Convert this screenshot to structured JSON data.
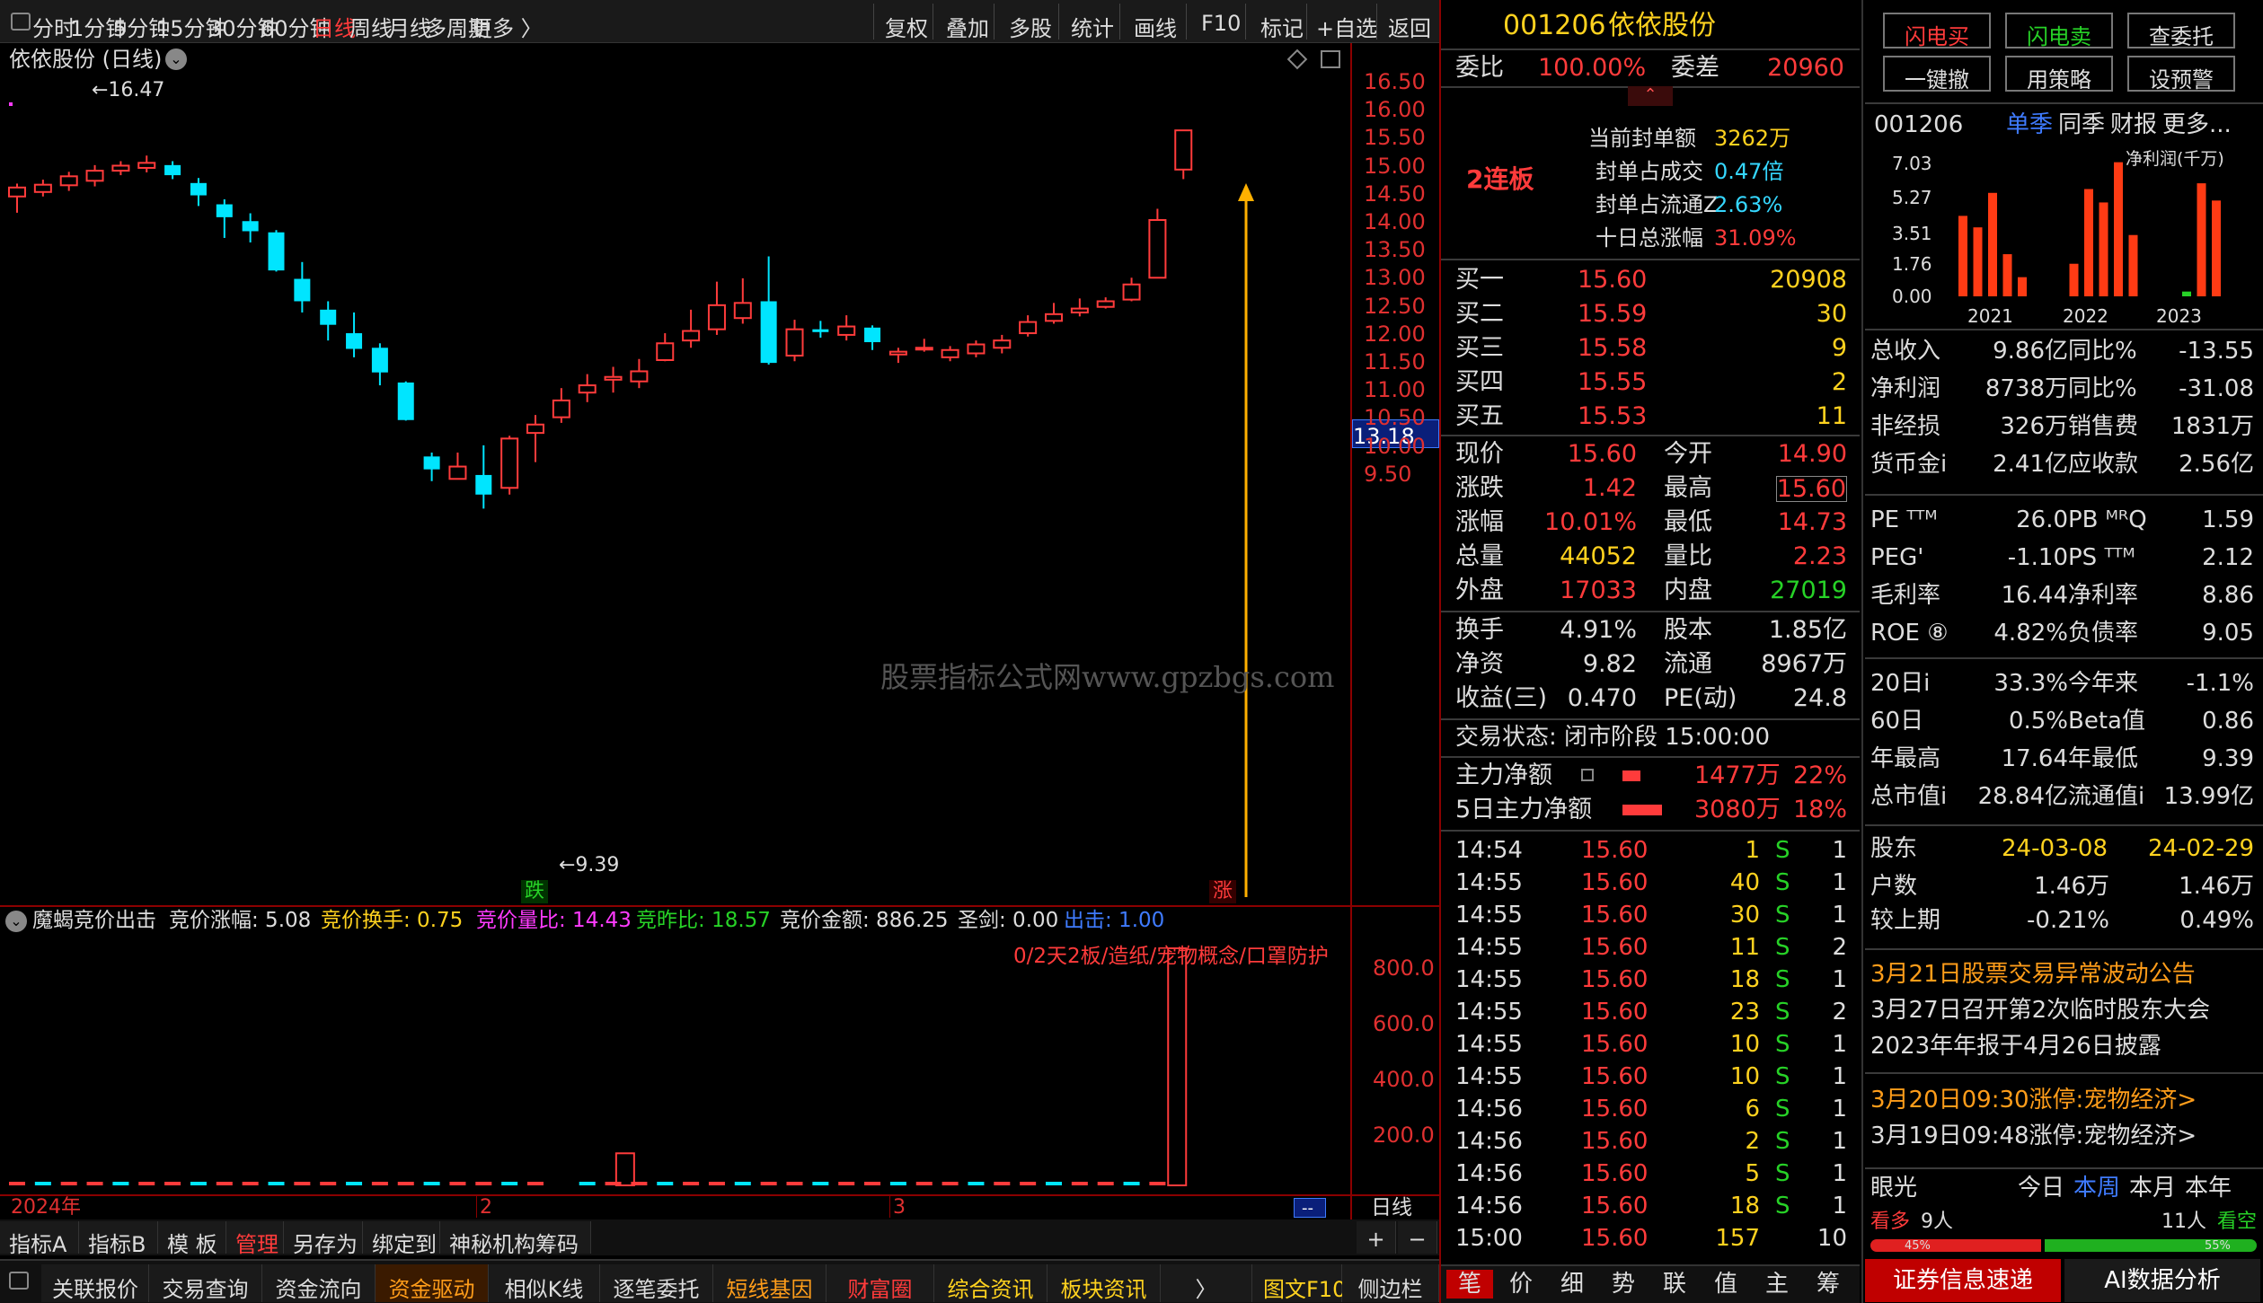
{
  "toolbar": {
    "periods": [
      "分时",
      "1分钟",
      "5分钟",
      "15分钟",
      "30分钟",
      "60分钟",
      "日线",
      "周线",
      "月线",
      "多周期",
      "更多 〉"
    ],
    "tools": [
      "复权",
      "叠加",
      "多股",
      "统计",
      "画线",
      "F10",
      "标记",
      "+自选",
      "返回"
    ]
  },
  "chart": {
    "title": "依依股份 (日线)",
    "high_label": "←16.47",
    "low_label": "←9.39",
    "watermark": "股票指标公式网www.gpzbgs.com",
    "current_price_tag": "13.18",
    "drop_tag": "跌",
    "rise_tag": "涨",
    "y_labels": [
      "16.50",
      "16.00",
      "15.50",
      "15.00",
      "14.50",
      "14.00",
      "13.50",
      "13.00",
      "12.50",
      "12.00",
      "11.50",
      "11.00",
      "10.50",
      "10.00",
      "9.50"
    ],
    "time_labels": [
      "2024年",
      "2",
      "3"
    ],
    "period_label": "日线",
    "nav": "--"
  },
  "chart_data": {
    "type": "candlestick",
    "title": "依依股份 (日线)",
    "ylim": [
      9.2,
      16.7
    ],
    "candles": [
      [
        14.42,
        14.58,
        14.13,
        14.65
      ],
      [
        14.5,
        14.63,
        14.42,
        14.72
      ],
      [
        14.62,
        14.78,
        14.52,
        14.86
      ],
      [
        14.7,
        14.88,
        14.6,
        14.98
      ],
      [
        14.88,
        14.97,
        14.8,
        15.05
      ],
      [
        14.93,
        15.02,
        14.85,
        15.15
      ],
      [
        14.98,
        14.8,
        14.73,
        15.05
      ],
      [
        14.66,
        14.44,
        14.25,
        14.75
      ],
      [
        14.28,
        14.05,
        13.68,
        14.37
      ],
      [
        13.98,
        13.8,
        13.6,
        14.12
      ],
      [
        13.78,
        13.1,
        13.08,
        13.82
      ],
      [
        12.95,
        12.55,
        12.35,
        13.25
      ],
      [
        12.4,
        12.13,
        11.85,
        12.55
      ],
      [
        11.98,
        11.7,
        11.55,
        12.35
      ],
      [
        11.72,
        11.28,
        11.05,
        11.8
      ],
      [
        11.1,
        10.43,
        10.42,
        11.12
      ],
      [
        9.78,
        9.55,
        9.34,
        9.85
      ],
      [
        9.38,
        9.6,
        9.39,
        9.85
      ],
      [
        9.45,
        9.1,
        8.85,
        9.98
      ],
      [
        9.22,
        10.1,
        9.1,
        10.15
      ],
      [
        10.2,
        10.35,
        9.68,
        10.52
      ],
      [
        10.48,
        10.78,
        10.38,
        11.0
      ],
      [
        10.92,
        11.05,
        10.75,
        11.25
      ],
      [
        11.15,
        11.2,
        10.92,
        11.38
      ],
      [
        11.12,
        11.3,
        11.0,
        11.52
      ],
      [
        11.5,
        11.8,
        11.48,
        11.98
      ],
      [
        11.85,
        12.02,
        11.72,
        12.4
      ],
      [
        12.05,
        12.48,
        11.95,
        12.9
      ],
      [
        12.25,
        12.52,
        12.15,
        12.96
      ],
      [
        12.55,
        11.45,
        11.42,
        13.35
      ],
      [
        11.58,
        12.05,
        11.48,
        12.22
      ],
      [
        12.05,
        12.0,
        11.9,
        12.2
      ],
      [
        11.95,
        12.1,
        11.85,
        12.3
      ],
      [
        12.08,
        11.82,
        11.68,
        12.12
      ],
      [
        11.6,
        11.65,
        11.45,
        11.72
      ],
      [
        11.7,
        11.72,
        11.65,
        11.88
      ],
      [
        11.55,
        11.68,
        11.48,
        11.75
      ],
      [
        11.62,
        11.78,
        11.55,
        11.85
      ],
      [
        11.72,
        11.85,
        11.62,
        11.95
      ],
      [
        11.98,
        12.18,
        11.92,
        12.3
      ],
      [
        12.2,
        12.32,
        12.15,
        12.52
      ],
      [
        12.35,
        12.42,
        12.28,
        12.6
      ],
      [
        12.45,
        12.55,
        12.42,
        12.62
      ],
      [
        12.58,
        12.85,
        12.55,
        12.97
      ],
      [
        12.97,
        14.0,
        12.97,
        14.2
      ],
      [
        14.9,
        15.6,
        14.73,
        15.6
      ]
    ],
    "marker_up_price": 14.56
  },
  "indicator": {
    "name": "魔蝎竞价出击",
    "items": [
      {
        "label": "竞价涨幅: 5.08",
        "color": "#dddddd"
      },
      {
        "label": "竞价换手: 0.75",
        "color": "#ffd21f"
      },
      {
        "label": "竞价量比: 14.43",
        "color": "#ff3bff"
      },
      {
        "label": "竞昨比: 18.57",
        "color": "#27d227"
      },
      {
        "label": "竞价金额: 886.25",
        "color": "#dddddd"
      },
      {
        "label": "圣剑: 0.00",
        "color": "#dddddd"
      },
      {
        "label": "出击: 1.00",
        "color": "#3f7bff"
      }
    ],
    "note": "0/2天2板/造纸/宠物概念/口罩防护",
    "y_labels": [
      "800.0",
      "600.0",
      "400.0",
      "200.0"
    ],
    "ylim": [
      0,
      1000
    ],
    "bars": [
      12,
      10,
      15,
      10,
      18,
      12,
      14,
      9,
      11,
      13,
      16,
      10,
      12,
      14,
      13,
      11,
      12,
      15,
      10,
      12,
      11,
      115,
      14,
      12,
      10,
      9,
      11,
      10,
      13,
      12,
      14,
      10,
      12,
      11,
      9,
      10,
      12,
      11,
      13,
      12,
      11,
      10,
      14,
      13,
      12,
      886.25
    ]
  },
  "bottom_tabs1": [
    "指标A",
    "指标B",
    "模 板",
    "管理",
    "另存为",
    "绑定到",
    "神秘机构筹码"
  ],
  "bottom_tabs1_right": [
    "+",
    "−"
  ],
  "bottom_tabs2": [
    "关联报价",
    "交易查询",
    "资金流向",
    "资金驱动",
    "相似K线",
    "逐笔委托",
    "短线基因",
    "财富圈",
    "综合资讯",
    "板块资讯",
    "〉",
    "图文F10",
    "侧边栏"
  ],
  "stock": {
    "code": "001206",
    "name": "依依股份",
    "weibi_label": "委比",
    "weibi": "100.00%",
    "weicha_label": "委差",
    "weicha": "20960",
    "board": "2连板",
    "seal": [
      {
        "label": "当前封单额",
        "value": "3262万",
        "vc": "#ffd21f"
      },
      {
        "label": "封单占成交",
        "value": "0.47倍",
        "vc": "#35d7ff"
      },
      {
        "label": "封单占流通Z",
        "value": "2.63%",
        "vc": "#35d7ff"
      },
      {
        "label": "十日总涨幅",
        "value": "31.09%",
        "vc": "#ff3b3b"
      }
    ],
    "bids": [
      {
        "label": "买一",
        "price": "15.60",
        "vol": "20908"
      },
      {
        "label": "买二",
        "price": "15.59",
        "vol": "30"
      },
      {
        "label": "买三",
        "price": "15.58",
        "vol": "9"
      },
      {
        "label": "买四",
        "price": "15.55",
        "vol": "2"
      },
      {
        "label": "买五",
        "price": "15.53",
        "vol": "11"
      }
    ],
    "quote": [
      [
        "现价",
        "15.60",
        "#ff3b3b",
        "今开",
        "14.90",
        "#ff3b3b"
      ],
      [
        "涨跌",
        "1.42",
        "#ff3b3b",
        "最高",
        "15.60",
        "#ff3b3b"
      ],
      [
        "涨幅",
        "10.01%",
        "#ff3b3b",
        "最低",
        "14.73",
        "#ff3b3b"
      ],
      [
        "总量",
        "44052",
        "#ffd21f",
        "量比",
        "2.23",
        "#ff3b3b"
      ],
      [
        "外盘",
        "17033",
        "#ff3b3b",
        "内盘",
        "27019",
        "#27d227"
      ]
    ],
    "quote2": [
      [
        "换手",
        "4.91%",
        "股本",
        "1.85亿"
      ],
      [
        "净资",
        "9.82",
        "流通",
        "8967万"
      ],
      [
        "收益(三)",
        "0.470",
        "PE(动)",
        "24.8"
      ]
    ],
    "status": "交易状态: 闭市阶段 15:00:00",
    "flows": [
      {
        "label": "主力净额",
        "value": "1477万",
        "pct": "22%"
      },
      {
        "label": "5日主力净额",
        "value": "3080万",
        "pct": "18%"
      }
    ],
    "ticks": [
      [
        "14:54",
        "15.60",
        "1",
        "S",
        "1"
      ],
      [
        "14:55",
        "15.60",
        "40",
        "S",
        "1"
      ],
      [
        "14:55",
        "15.60",
        "30",
        "S",
        "1"
      ],
      [
        "14:55",
        "15.60",
        "11",
        "S",
        "2"
      ],
      [
        "14:55",
        "15.60",
        "18",
        "S",
        "1"
      ],
      [
        "14:55",
        "15.60",
        "23",
        "S",
        "2"
      ],
      [
        "14:55",
        "15.60",
        "10",
        "S",
        "1"
      ],
      [
        "14:55",
        "15.60",
        "10",
        "S",
        "1"
      ],
      [
        "14:56",
        "15.60",
        "6",
        "S",
        "1"
      ],
      [
        "14:56",
        "15.60",
        "2",
        "S",
        "1"
      ],
      [
        "14:56",
        "15.60",
        "5",
        "S",
        "1"
      ],
      [
        "14:56",
        "15.60",
        "18",
        "S",
        "1"
      ],
      [
        "15:00",
        "15.60",
        "157",
        "",
        "10"
      ]
    ],
    "tick_tabs": [
      "笔",
      "价",
      "细",
      "势",
      "联",
      "值",
      "主",
      "筹"
    ]
  },
  "side": {
    "buttons": [
      "闪电买",
      "闪电卖",
      "查委托",
      "一键撤",
      "用策略",
      "设预警"
    ],
    "code": "001206",
    "fin_tabs": [
      "单季",
      "同季",
      "财报",
      "更多..."
    ],
    "chart_title": "净利润(千万)",
    "chart_y": [
      "7.03",
      "5.27",
      "3.51",
      "1.76",
      "0.00"
    ],
    "chart_years": [
      "2021",
      "2022",
      "2023"
    ],
    "fin_bars": [
      4.2,
      3.6,
      5.4,
      2.2,
      1.0,
      0,
      0,
      1.7,
      5.6,
      4.9,
      7.0,
      3.2,
      0,
      0,
      0.25,
      5.9,
      5.0
    ],
    "fin_rows": [
      [
        "总收入",
        "9.86亿",
        "同比%",
        "-13.55"
      ],
      [
        "净利润",
        "8738万",
        "同比%",
        "-31.08"
      ],
      [
        "非经损",
        "326万",
        "销售费",
        "1831万"
      ],
      [
        "货币金i",
        "2.41亿",
        "应收款",
        "2.56亿"
      ]
    ],
    "val_rows": [
      [
        "PE ᵀᵀᴹ",
        "26.0",
        "PB ᴹᴿQ",
        "1.59"
      ],
      [
        "PEG'",
        "-1.10",
        "PS ᵀᵀᴹ",
        "2.12"
      ],
      [
        "毛利率",
        "16.44",
        "净利率",
        "8.86"
      ],
      [
        "ROE ⑧",
        "4.82%",
        "负债率",
        "9.05"
      ]
    ],
    "perf_rows": [
      [
        "20日i",
        "33.3%",
        "今年来",
        "-1.1%"
      ],
      [
        "60日",
        "0.5%",
        "Beta值",
        "0.86"
      ],
      [
        "年最高",
        "17.64",
        "年最低",
        "9.39"
      ],
      [
        "总市值i",
        "28.84亿",
        "流通值i",
        "13.99亿"
      ]
    ],
    "holder_head": [
      "股东",
      "24-03-08",
      "24-02-29"
    ],
    "holder_rows": [
      [
        "户数",
        "1.46万",
        "1.46万"
      ],
      [
        "较上期",
        "-0.21%",
        "0.49%"
      ]
    ],
    "news": [
      "3月21日股票交易异常波动公告",
      "3月27日召开第2次临时股东大会",
      "2023年年报于4月26日披露",
      "3月20日09:30涨停:宠物经济>",
      "3月19日09:48涨停:宠物经济>"
    ],
    "eye": {
      "label": "眼光",
      "tabs": [
        "今日",
        "本周",
        "本月",
        "本年"
      ]
    },
    "sentiment": {
      "bull": "看多",
      "bull_n": "9人",
      "bear_n": "11人",
      "bear": "看空",
      "bull_pct": "45%",
      "bear_pct": "55%"
    },
    "footer": [
      "证券信息速递",
      "AI数据分析"
    ]
  }
}
